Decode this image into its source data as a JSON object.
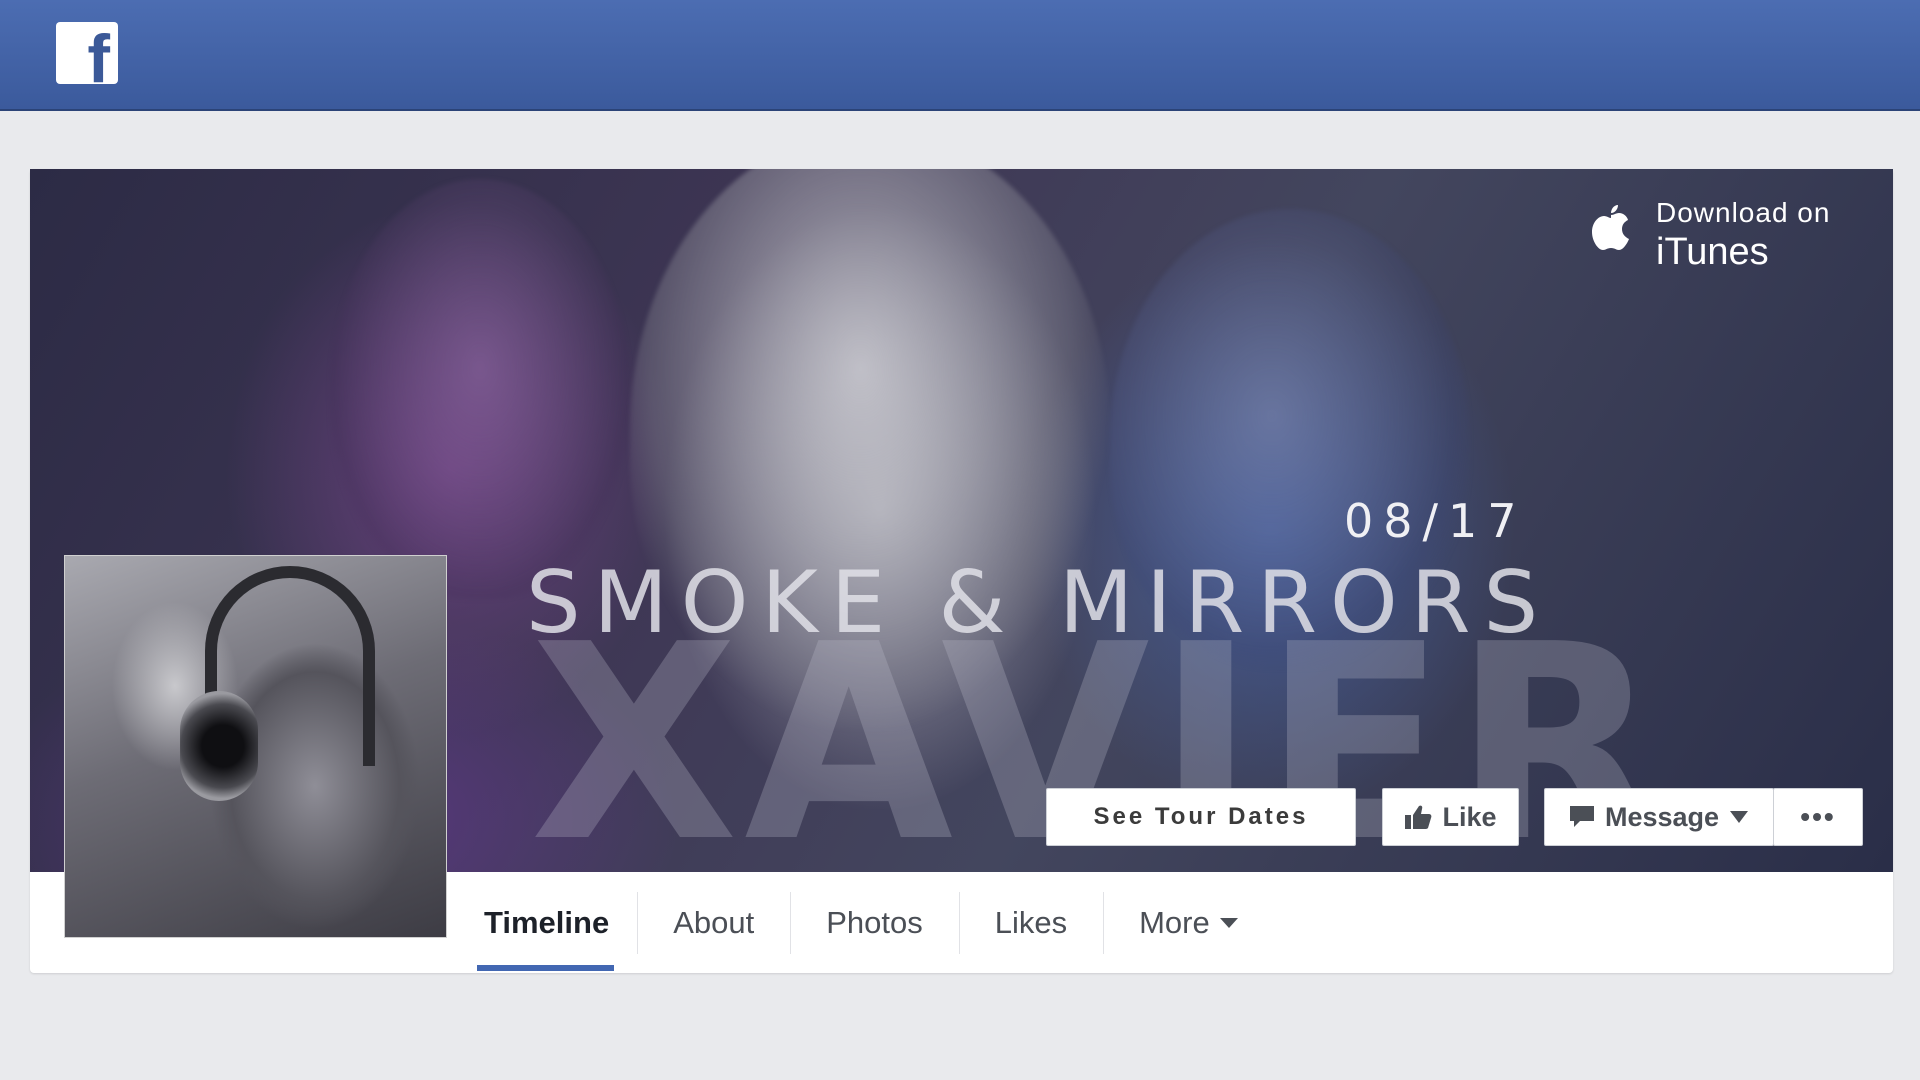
{
  "app": {
    "logo_letter": "f"
  },
  "cover": {
    "itunes": {
      "line1": "Download on",
      "line2": "iTunes"
    },
    "release_date": "08/17",
    "album_title": "SMOKE & MIRRORS",
    "artist_wordmark": "XAVIER"
  },
  "actions": {
    "tour_label": "See Tour Dates",
    "like_label": "Like",
    "message_label": "Message",
    "more_label": "•••"
  },
  "tabs": [
    {
      "label": "Timeline",
      "active": true
    },
    {
      "label": "About"
    },
    {
      "label": "Photos"
    },
    {
      "label": "Likes"
    },
    {
      "label": "More"
    }
  ],
  "colors": {
    "header_blue": "#3b5998",
    "tab_underline": "#4267b2",
    "page_bg": "#e9eaed"
  },
  "icons": [
    "facebook-logo-icon",
    "apple-icon",
    "thumbs-up-icon",
    "speech-bubble-icon",
    "caret-down-icon",
    "ellipsis-icon"
  ]
}
